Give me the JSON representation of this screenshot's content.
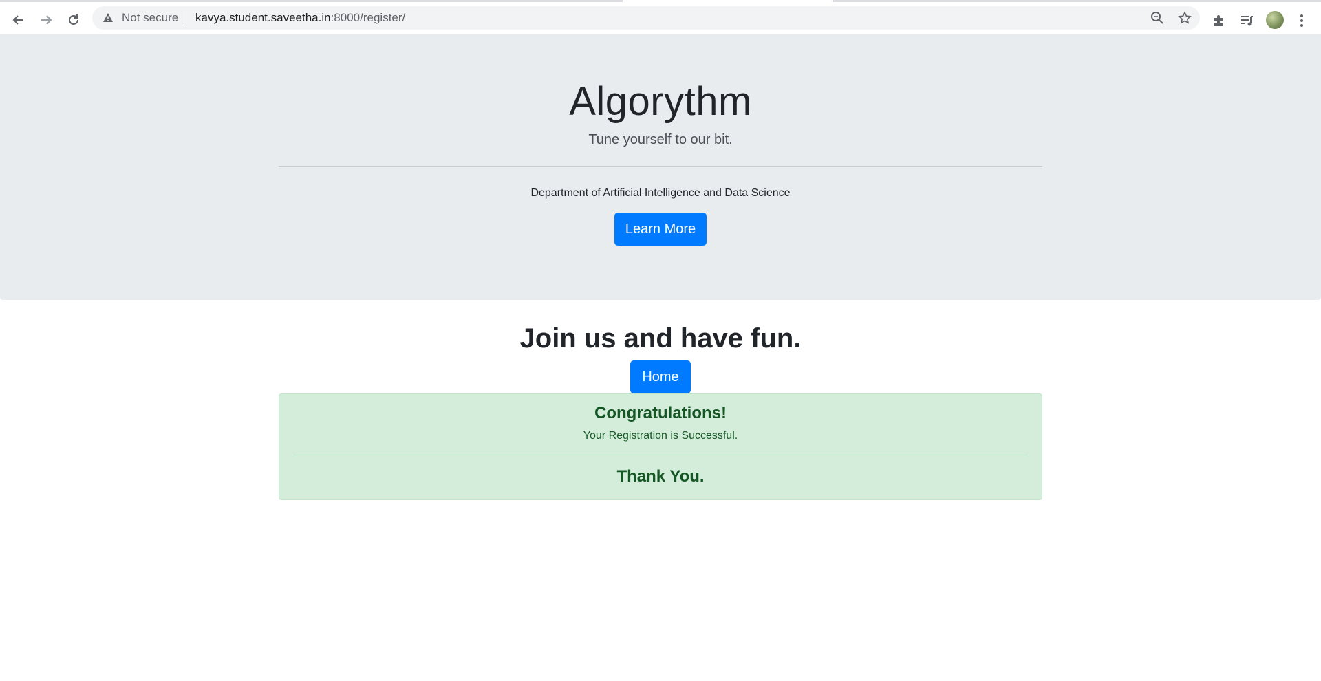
{
  "browser": {
    "security_label": "Not secure",
    "url_host": "kavya.student.saveetha.in",
    "url_rest": ":8000/register/"
  },
  "jumbotron": {
    "title": "Algorythm",
    "tagline": "Tune yourself to our bit.",
    "department": "Department of Artificial Intelligence and Data Science",
    "learn_more_label": "Learn More"
  },
  "main": {
    "heading": "Join us and have fun.",
    "home_label": "Home"
  },
  "alert": {
    "heading": "Congratulations!",
    "message": "Your Registration is Successful.",
    "footer": "Thank You."
  },
  "colors": {
    "primary": "#007bff",
    "jumbotron_bg": "#e9ecef",
    "success_bg": "#d4edda",
    "success_text": "#155724"
  }
}
